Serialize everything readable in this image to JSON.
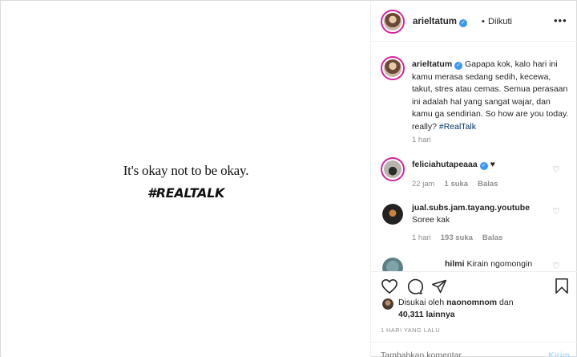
{
  "image": {
    "quote": "It's okay not to be okay.",
    "hashtag": "#REALTALK"
  },
  "header": {
    "username": "arieltatum",
    "separator": "•",
    "follow_status": "Diikuti",
    "more_icon": "more-horizontal-icon"
  },
  "caption": {
    "username": "arieltatum",
    "text": "Gapapa kok, kalo hari ini kamu merasa sedang sedih, kecewa, takut, stres atau cemas. Semua perasaan ini adalah hal yang sangat wajar, dan kamu ga sendirian. So how are you today. really?",
    "hashtag": "#RealTalk",
    "time": "1 hari"
  },
  "comments": [
    {
      "username": "feliciahutapeaaa",
      "text": "♥",
      "time": "22 jam",
      "likes": "1 suka",
      "reply": "Balas"
    },
    {
      "username": "jual.subs.jam.tayang.youtube",
      "text": "Soree kak",
      "time": "1 hari",
      "likes": "193 suka",
      "reply": "Balas"
    },
    {
      "username": "hilmi",
      "text": "Kirain ngomongin"
    }
  ],
  "likes": {
    "prefix": "Disukai oleh",
    "user": "naonomnom",
    "mid": "dan",
    "count": "40,311 lainnya"
  },
  "timestamp": "1 HARI YANG LALU",
  "add_comment": {
    "placeholder": "Tambahkan komentar...",
    "post_label": "Kirim"
  },
  "colors": {
    "verified": "#3897f0",
    "story_ring": "#d6249f",
    "link": "#00376b",
    "muted": "#8e8e8e"
  }
}
